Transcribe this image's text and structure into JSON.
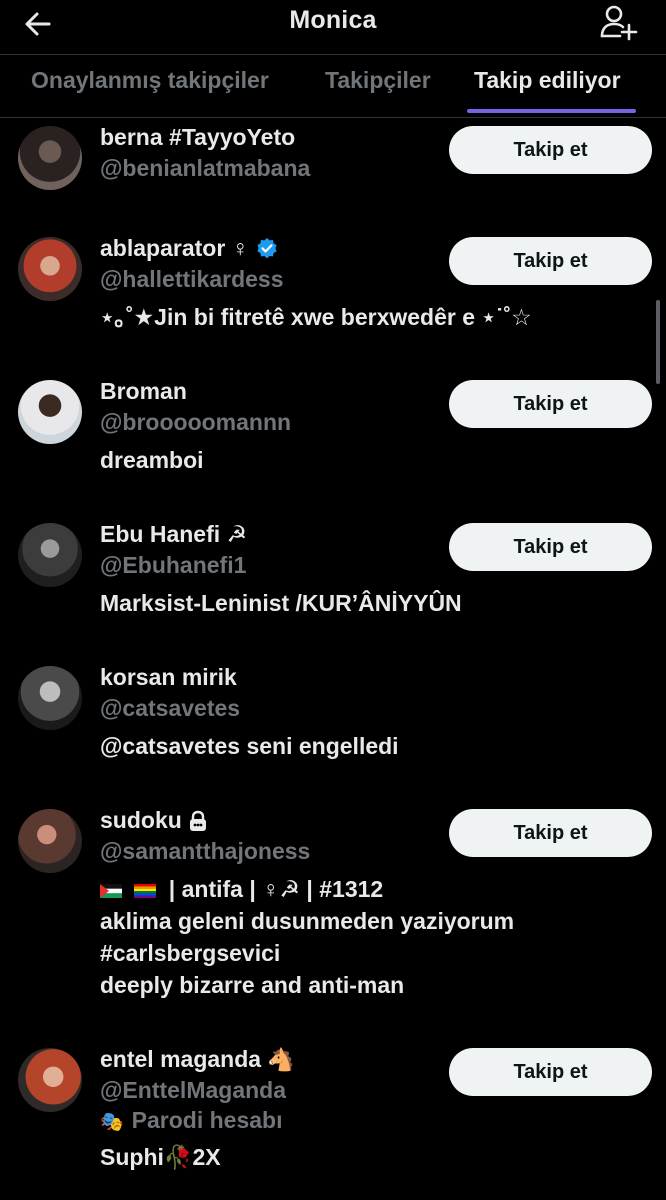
{
  "header": {
    "title": "Monica",
    "back_icon": "arrow-left-icon",
    "add_icon": "add-user-icon"
  },
  "tabs": [
    {
      "label": "Onaylanmış takipçiler",
      "active": false
    },
    {
      "label": "Takipçiler",
      "active": false
    },
    {
      "label": "Takip ediliyor",
      "active": true
    }
  ],
  "colors": {
    "background": "#000000",
    "text": "#e7e9ea",
    "muted": "#71767b",
    "tab_indicator": "#7b61e6",
    "verified": "#1d9bf0",
    "button_bg": "#eff3f4"
  },
  "users": [
    {
      "name": "berna #TayyoYeto",
      "handle": "@benianlatmabana",
      "bio": [],
      "button": "Takip et"
    },
    {
      "name": "ablaparator ♀",
      "verified": true,
      "handle": "@hallettikardess",
      "bio": [
        "⋆｡˚★Jin bi fitretê xwe berxwedêr e ⋆˙˚☆"
      ],
      "button": "Takip et"
    },
    {
      "name": "Broman",
      "handle": "@brooooomannn",
      "bio": [
        "dreamboi"
      ],
      "button": "Takip et"
    },
    {
      "name": "Ebu Hanefi ☭",
      "handle": "@Ebuhanefi1",
      "bio": [
        "Marksist-Leninist /KUR’ÂNİYYÛN"
      ],
      "button": "Takip et"
    },
    {
      "name": "korsan mirik",
      "handle": "@catsavetes",
      "bio": [
        "@catsavetes seni engelledi"
      ],
      "button": ""
    },
    {
      "name": "sudoku",
      "locked": true,
      "handle": "@samantthajoness",
      "bio": [
        "| antifa | ♀☭ | #1312",
        "aklima geleni dusunmeden yaziyorum",
        "#carlsbergsevici",
        "deeply bizarre and anti-man"
      ],
      "button": "Takip et"
    },
    {
      "name": "entel maganda",
      "handle": "@EnttelMaganda",
      "note": "Parodi hesabı",
      "bio": [
        "Suphi🥀2X"
      ],
      "button": "Takip et"
    }
  ]
}
